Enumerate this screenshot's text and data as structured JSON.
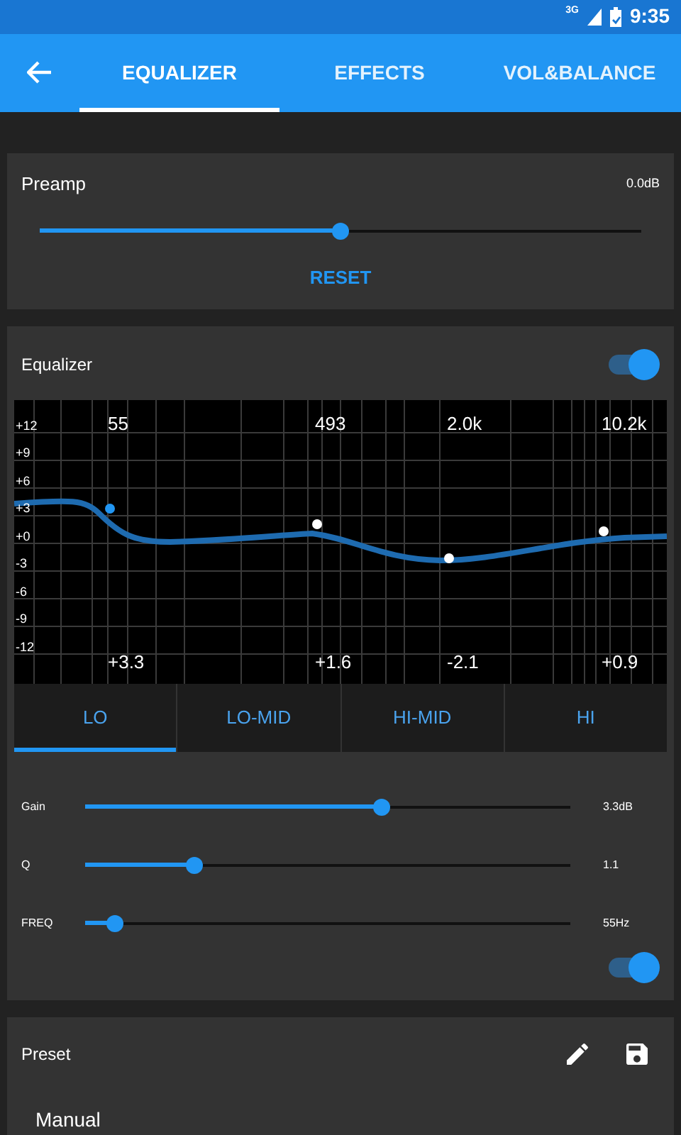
{
  "status_bar": {
    "time": "9:35",
    "network": "3G"
  },
  "tabs": [
    {
      "label": "EQUALIZER",
      "selected": true
    },
    {
      "label": "EFFECTS",
      "selected": false
    },
    {
      "label": "VOL&BALANCE",
      "selected": false
    }
  ],
  "preamp": {
    "label": "Preamp",
    "reading": "0.0dB",
    "level": 0.5,
    "button": "RESET"
  },
  "equalizer": {
    "label": "Equalizer",
    "on": true,
    "y_labels": [
      "+12",
      "+9",
      "+6",
      "+3",
      "+0",
      "-3",
      "-6",
      "-9",
      "-12"
    ],
    "points": [
      {
        "freq": "55",
        "gain": "+3.3",
        "selected": true
      },
      {
        "freq": "493",
        "gain": "+1.6",
        "selected": false
      },
      {
        "freq": "2.0k",
        "gain": "-2.1",
        "selected": false
      },
      {
        "freq": "10.2k",
        "gain": "+0.9",
        "selected": false
      }
    ],
    "bands": [
      {
        "label": "LO",
        "selected": true
      },
      {
        "label": "LO-MID",
        "selected": false
      },
      {
        "label": "HI-MID",
        "selected": false
      },
      {
        "label": "HI",
        "selected": false
      }
    ],
    "sliders": [
      {
        "label": "Gain",
        "level": 0.61,
        "reading": "3.3dB"
      },
      {
        "label": "Q",
        "level": 0.225,
        "reading": "1.1"
      },
      {
        "label": "FREQ",
        "level": 0.06,
        "reading": "55Hz"
      }
    ],
    "band_on": true
  },
  "preset": {
    "label": "Preset",
    "value": "Manual"
  }
}
